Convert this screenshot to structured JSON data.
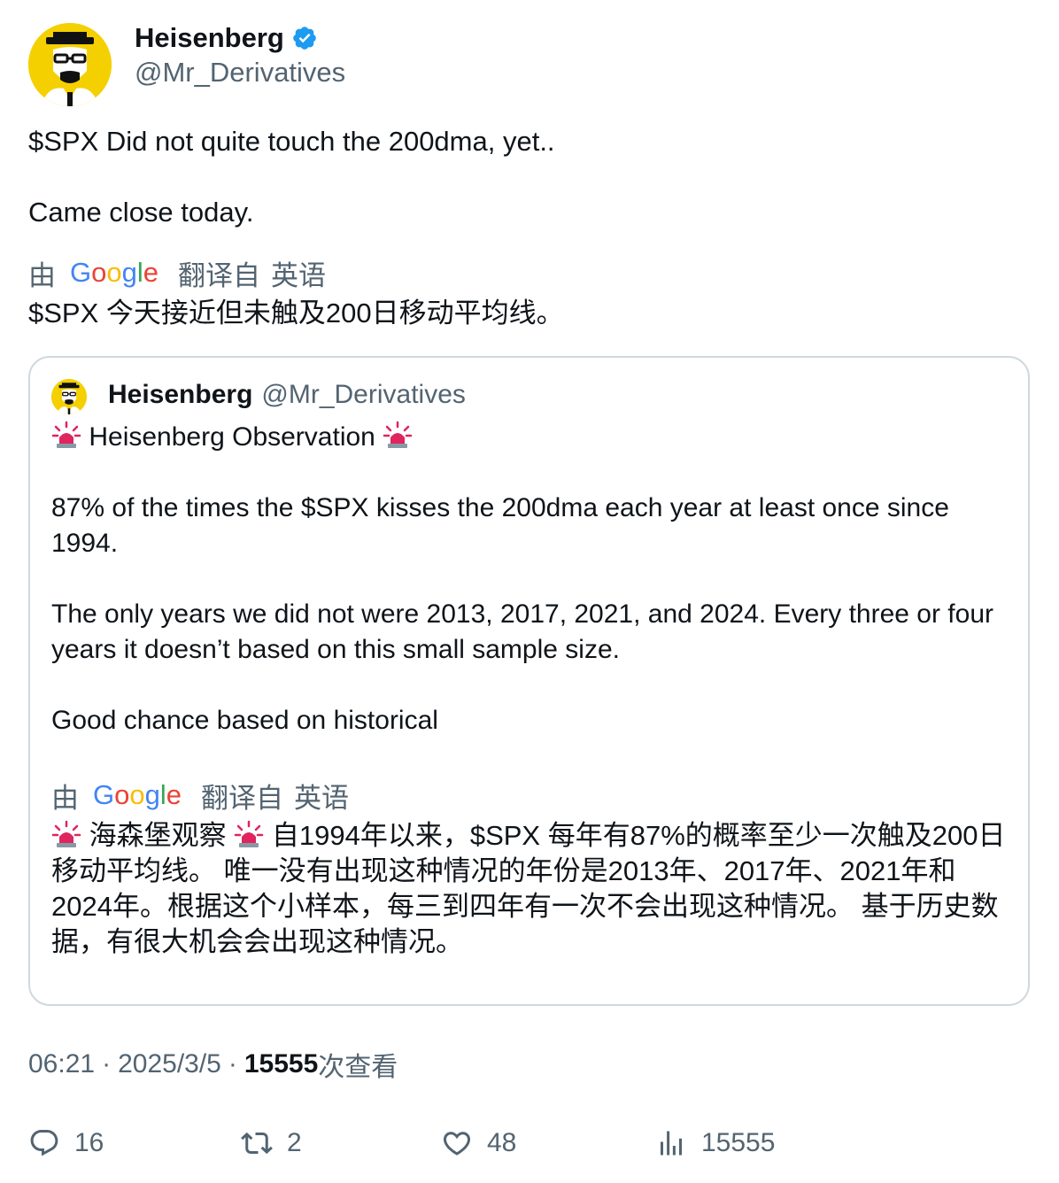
{
  "author": {
    "display_name": "Heisenberg",
    "handle": "@Mr_Derivatives",
    "verified": true,
    "avatar_icon": "heisenberg-avatar"
  },
  "tweet": {
    "lines": [
      "$SPX Did not quite touch the 200dma, yet..",
      "Came close today."
    ],
    "translation": {
      "by_label": "由",
      "provider": "Google",
      "label": "翻译自",
      "language": "英语",
      "text": "$SPX 今天接近但未触及200日移动平均线。"
    }
  },
  "quote": {
    "display_name": "Heisenberg",
    "handle": "@Mr_Derivatives",
    "title": "Heisenberg Observation",
    "paragraphs": [
      "87% of the times the $SPX kisses the 200dma each year at least once since 1994.",
      "The only years we did not were 2013, 2017, 2021, and 2024. Every three or four years it doesn’t based on this small sample size.",
      "Good chance based on historical"
    ],
    "translation": {
      "by_label": "由",
      "provider": "Google",
      "label": "翻译自",
      "language": "英语",
      "title": "海森堡观察",
      "text": "自1994年以来，$SPX 每年有87%的概率至少一次触及200日移动平均线。 唯一没有出现这种情况的年份是2013年、2017年、2021年和2024年。根据这个小样本，每三到四年有一次不会出现这种情况。 基于历史数据，有很大机会会出现这种情况。"
    }
  },
  "meta": {
    "time": "06:21",
    "separator": "·",
    "date": "2025/3/5",
    "views_count": "15555",
    "views_label": "次查看"
  },
  "actions": {
    "replies": "16",
    "retweets": "2",
    "likes": "48",
    "views": "15555"
  },
  "colors": {
    "text": "#0f1419",
    "secondary": "#536471",
    "border": "#cfd9de",
    "verified": "#1d9bf0",
    "google_blue": "#4285F4",
    "google_red": "#EA4335",
    "google_yellow": "#FBBC05",
    "google_green": "#34A853"
  }
}
